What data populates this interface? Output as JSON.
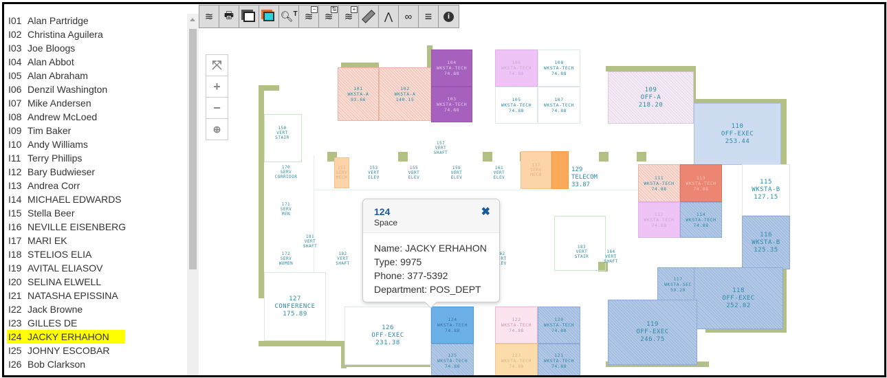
{
  "occupants": [
    {
      "code": "I01",
      "name": "Alan Partridge"
    },
    {
      "code": "I02",
      "name": "Christina Aguilera"
    },
    {
      "code": "I03",
      "name": "Joe Bloogs"
    },
    {
      "code": "I04",
      "name": "Alan Abbot"
    },
    {
      "code": "I05",
      "name": "Alan Abraham"
    },
    {
      "code": "I06",
      "name": "Denzil Washington"
    },
    {
      "code": "I07",
      "name": "Mike Andersen"
    },
    {
      "code": "I08",
      "name": "Andrew McLoed"
    },
    {
      "code": "I09",
      "name": "Tim Baker"
    },
    {
      "code": "I10",
      "name": "Andy Williams"
    },
    {
      "code": "I11",
      "name": "Terry Phillips"
    },
    {
      "code": "I12",
      "name": "Bary Budwieser"
    },
    {
      "code": "I13",
      "name": "Andrea Corr"
    },
    {
      "code": "I14",
      "name": "MICHAEL EDWARDS"
    },
    {
      "code": "I15",
      "name": "Stella Beer"
    },
    {
      "code": "I16",
      "name": "NEVILLE EISENBERG"
    },
    {
      "code": "I17",
      "name": "MARI EK"
    },
    {
      "code": "I18",
      "name": "STELIOS ELIA"
    },
    {
      "code": "I19",
      "name": "AVITAL ELIASOV"
    },
    {
      "code": "I20",
      "name": "SELINA ELWELL"
    },
    {
      "code": "I21",
      "name": "NATASHA EPISSINA"
    },
    {
      "code": "I22",
      "name": "Jack Browne"
    },
    {
      "code": "I23",
      "name": "GILLES DE"
    },
    {
      "code": "I24",
      "name": "JACKY ERHAHON"
    },
    {
      "code": "I25",
      "name": "JOHNY ESCOBAR"
    },
    {
      "code": "I26",
      "name": "Bob Clarkson"
    }
  ],
  "selected_occupant": "I24",
  "highlight_color": "#ffff00",
  "toolbar": [
    {
      "icon": "layers-icon"
    },
    {
      "icon": "print-icon"
    },
    {
      "icon": "window-icon"
    },
    {
      "icon": "color-window-icon"
    },
    {
      "icon": "text-search-icon",
      "glyph": "T"
    },
    {
      "icon": "layer-minus-icon",
      "badge": "−"
    },
    {
      "icon": "layer-swap-icon",
      "badge": "⇅"
    },
    {
      "icon": "layer-plus-icon",
      "badge": "+"
    },
    {
      "icon": "ruler-icon"
    },
    {
      "icon": "compass-icon"
    },
    {
      "icon": "binoculars-icon"
    },
    {
      "icon": "legend-list-icon"
    },
    {
      "icon": "info-icon"
    }
  ],
  "zoom_controls": [
    {
      "icon": "fit-extent-icon",
      "glyph": "⤧"
    },
    {
      "icon": "zoom-in-icon",
      "glyph": "+"
    },
    {
      "icon": "zoom-out-icon",
      "glyph": "−"
    },
    {
      "icon": "zoom-box-icon",
      "glyph": "⊕"
    }
  ],
  "rooms": [
    {
      "id": "101",
      "type": "WKSTA-A",
      "area": "93.66"
    },
    {
      "id": "102",
      "type": "WKSTA-A",
      "area": "140.15"
    },
    {
      "id": "104",
      "type": "WKSTA-TECH",
      "area": "74.88"
    },
    {
      "id": "103",
      "type": "WKSTA-TECH",
      "area": "74.88"
    },
    {
      "id": "106",
      "type": "WKSTA-TECH",
      "area": "74.88"
    },
    {
      "id": "108",
      "type": "WKSTA-TECH",
      "area": "74.88"
    },
    {
      "id": "105",
      "type": "WKSTA-TECH",
      "area": "74.88"
    },
    {
      "id": "107",
      "type": "WKSTA-TECH",
      "area": "74.88"
    },
    {
      "id": "109",
      "type": "OFF-A",
      "area": "218.20"
    },
    {
      "id": "110",
      "type": "OFF-EXEC",
      "area": "253.44"
    },
    {
      "id": "111",
      "type": "WKSTA-TECH",
      "area": "74.88"
    },
    {
      "id": "113",
      "type": "WKSTA-TECH",
      "area": "74.88"
    },
    {
      "id": "112",
      "type": "WKSTA-TECH",
      "area": "74.88"
    },
    {
      "id": "114",
      "type": "WKSTA-TECH",
      "area": "74.88"
    },
    {
      "id": "115",
      "type": "WKSTA-B",
      "area": "127.15"
    },
    {
      "id": "116",
      "type": "WKSTA-B",
      "area": "125.35"
    },
    {
      "id": "117",
      "type": "WKSTA-SEC",
      "area": "59.20"
    },
    {
      "id": "118",
      "type": "OFF-EXEC",
      "area": "252.02"
    },
    {
      "id": "119",
      "type": "OFF-EXEC",
      "area": "246.75"
    },
    {
      "id": "126",
      "type": "OFF-EXEC",
      "area": "231.38"
    },
    {
      "id": "124",
      "type": "WKSTA-TECH",
      "area": "74.88"
    },
    {
      "id": "125",
      "type": "WKSTA-TECH",
      "area": "74.88"
    },
    {
      "id": "122",
      "type": "WKSTA-TECH",
      "area": "74.88"
    },
    {
      "id": "120",
      "type": "WKSTA-TECH",
      "area": "74.88"
    },
    {
      "id": "123",
      "type": "WKSTA-TECH",
      "area": "74.88"
    },
    {
      "id": "121",
      "type": "WKSTA-TECH",
      "area": "74.88"
    },
    {
      "id": "127",
      "type": "CONFERENCE",
      "area": "175.89"
    },
    {
      "id": "129",
      "type": "TELECOM",
      "area": "33.87"
    }
  ],
  "service_spaces": [
    {
      "id": "150",
      "line1": "VERT",
      "line2": "STAIR"
    },
    {
      "id": "170",
      "line1": "SERV",
      "line2": "CORRIDOR"
    },
    {
      "id": "171",
      "line1": "SERV",
      "line2": "MEN"
    },
    {
      "id": "172",
      "line1": "SERV",
      "line2": "WOMEN"
    },
    {
      "id": "181",
      "line1": "VERT",
      "line2": "SHAFT"
    },
    {
      "id": "152",
      "line1": "SERV",
      "line2": "MECH"
    },
    {
      "id": "153",
      "line1": "VERT",
      "line2": "ELEV"
    },
    {
      "id": "155",
      "line1": "VERT",
      "line2": "ELEV"
    },
    {
      "id": "157",
      "line1": "VERT",
      "line2": "SHAFT"
    },
    {
      "id": "159",
      "line1": "VERT",
      "line2": "ELEV"
    },
    {
      "id": "161",
      "line1": "VERT",
      "line2": "ELEV"
    },
    {
      "id": "137",
      "line1": "SERV",
      "line2": "MECH"
    },
    {
      "id": "182",
      "line1": "VERT",
      "line2": "SHAFT"
    },
    {
      "id": "162",
      "line1": "VERT",
      "line2": "ELEV"
    },
    {
      "id": "183",
      "line1": "VERT",
      "line2": "STAIR"
    },
    {
      "id": "184",
      "line1": "VERT",
      "line2": "SHAFT"
    }
  ],
  "popup": {
    "title": "124",
    "subtitle": "Space",
    "close_glyph": "✖",
    "lines": [
      "Name: JACKY ERHAHON",
      "Type: 9975",
      "Phone: 377-5392",
      "Department: POS_DEPT"
    ]
  }
}
